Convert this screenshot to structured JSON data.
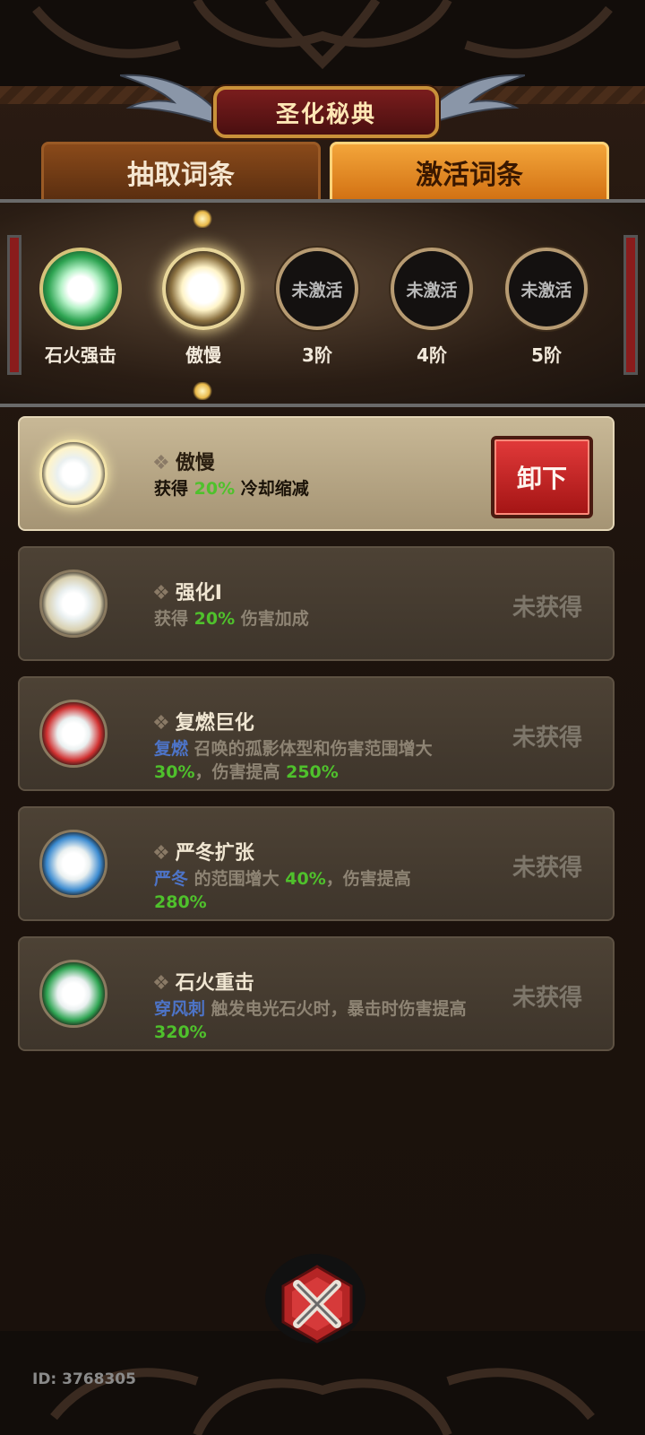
{
  "title": "圣化秘典",
  "tabs": {
    "draw": "抽取词条",
    "activate": "激活词条"
  },
  "slots": [
    {
      "label": "石火强击",
      "ring_text": "",
      "state": "green"
    },
    {
      "label": "傲慢",
      "ring_text": "",
      "state": "gold"
    },
    {
      "label": "3阶",
      "ring_text": "未激活",
      "state": "empty"
    },
    {
      "label": "4阶",
      "ring_text": "未激活",
      "state": "empty"
    },
    {
      "label": "5阶",
      "ring_text": "未激活",
      "state": "empty"
    }
  ],
  "entries": [
    {
      "name": "傲慢",
      "desc": [
        {
          "t": "获得 "
        },
        {
          "t": "20%",
          "c": "g"
        },
        {
          "t": " 冷却缩减"
        }
      ],
      "status": "",
      "button": "卸下",
      "orb_color": "#fff4c8",
      "active": true
    },
    {
      "name": "强化I",
      "desc": [
        {
          "t": "获得 "
        },
        {
          "t": "20%",
          "c": "g"
        },
        {
          "t": " 伤害加成"
        }
      ],
      "status": "未获得",
      "orb_color": "#d8cfae",
      "active": false
    },
    {
      "name": "复燃巨化",
      "desc": [
        {
          "t": "复燃",
          "c": "b"
        },
        {
          "t": " 召唤的孤影体型和伤害范围增大 "
        },
        {
          "t": "30%",
          "c": "g"
        },
        {
          "t": "，伤害提高 "
        },
        {
          "t": "250%",
          "c": "g"
        }
      ],
      "status": "未获得",
      "orb_color": "#d03030",
      "active": false
    },
    {
      "name": "严冬扩张",
      "desc": [
        {
          "t": "严冬",
          "c": "b"
        },
        {
          "t": " 的范围增大 "
        },
        {
          "t": "40%",
          "c": "g"
        },
        {
          "t": "，伤害提高 "
        },
        {
          "t": "280%",
          "c": "g"
        }
      ],
      "status": "未获得",
      "orb_color": "#3a8ad0",
      "active": false
    },
    {
      "name": "石火重击",
      "desc": [
        {
          "t": "穿风刺",
          "c": "b"
        },
        {
          "t": " 触发电光石火时，暴击时伤害提高 "
        },
        {
          "t": "320%",
          "c": "g"
        }
      ],
      "status": "未获得",
      "orb_color": "#2ea452",
      "active": false
    }
  ],
  "user_id": "ID: 3768305"
}
